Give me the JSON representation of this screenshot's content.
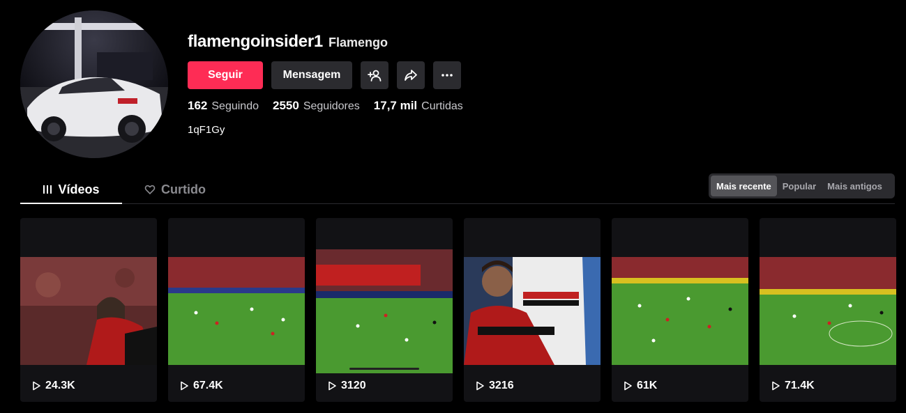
{
  "profile": {
    "username": "flamengoinsider1",
    "nickname": "Flamengo",
    "bio": "1qF1Gy"
  },
  "actions": {
    "follow_label": "Seguir",
    "message_label": "Mensagem"
  },
  "stats": [
    {
      "value": "162",
      "label": "Seguindo"
    },
    {
      "value": "2550",
      "label": "Seguidores"
    },
    {
      "value": "17,7 mil",
      "label": "Curtidas"
    }
  ],
  "tabs": {
    "videos": "Vídeos",
    "liked": "Curtido"
  },
  "sort": {
    "options": [
      "Mais recente",
      "Popular",
      "Mais antigos"
    ],
    "selected": "Mais recente"
  },
  "videos": [
    {
      "views": "24.3K"
    },
    {
      "views": "67.4K"
    },
    {
      "views": "3120"
    },
    {
      "views": "3216"
    },
    {
      "views": "61K"
    },
    {
      "views": "71.4K"
    }
  ],
  "colors": {
    "accent": "#fe2c55",
    "background": "#000000",
    "button": "#2b2b2f"
  },
  "icons": {
    "add_user": "add-user-icon",
    "share": "share-icon",
    "more": "more-icon",
    "videos_tab": "grid-bars-icon",
    "liked_tab": "heart-icon",
    "play": "play-icon"
  }
}
